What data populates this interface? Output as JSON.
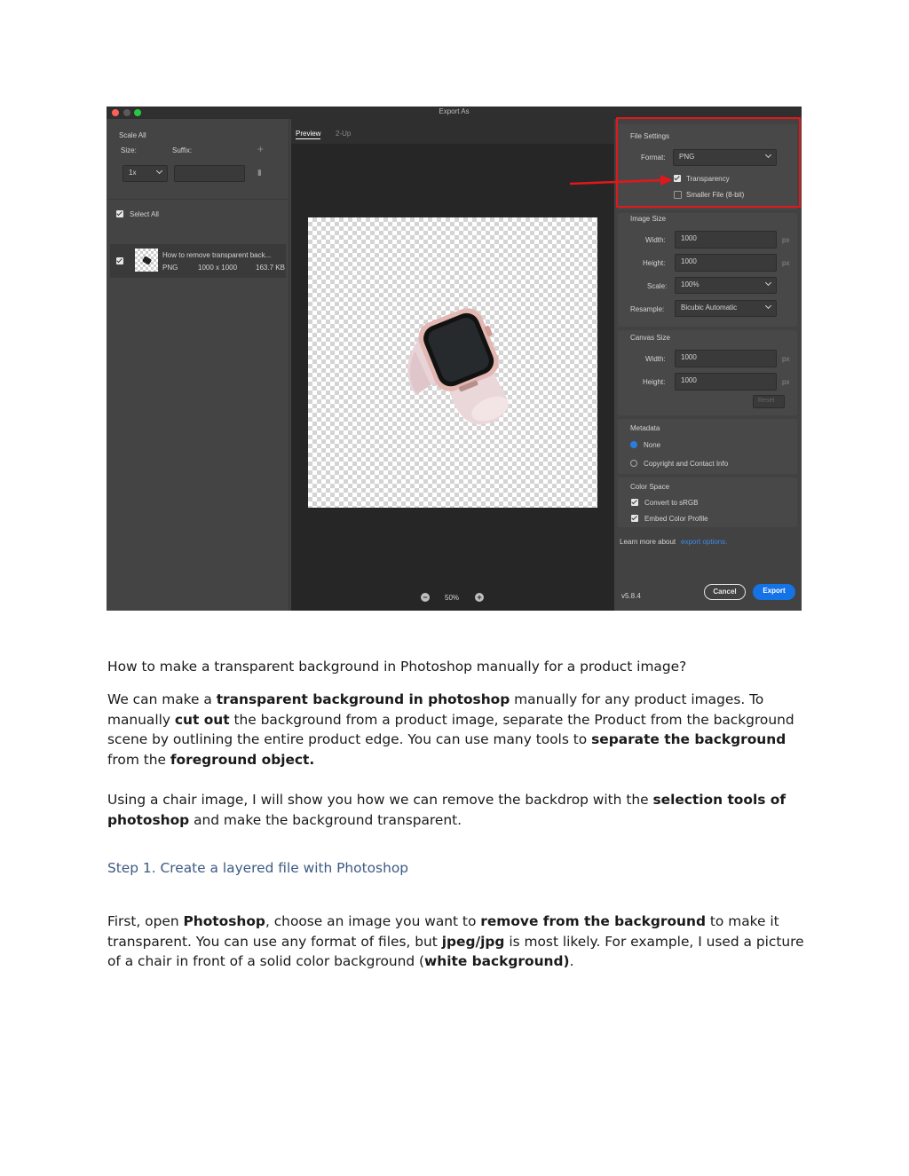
{
  "dialog": {
    "window_title": "Export As",
    "left": {
      "scale_all": "Scale All",
      "size_label": "Size:",
      "suffix_label": "Suffix:",
      "size_value": "1x",
      "select_all": "Select All",
      "file_name": "How to remove transparent back...",
      "file_format": "PNG",
      "file_dims": "1000 x 1000",
      "file_size": "163.7 KB"
    },
    "tabs": [
      "Preview",
      "2-Up"
    ],
    "zoom": "50%",
    "file_settings": {
      "heading": "File Settings",
      "format_label": "Format:",
      "format_value": "PNG",
      "transparency": "Transparency",
      "smaller_file": "Smaller File (8-bit)"
    },
    "image_size": {
      "heading": "Image Size",
      "width_label": "Width:",
      "width_value": "1000",
      "height_label": "Height:",
      "height_value": "1000",
      "scale_label": "Scale:",
      "scale_value": "100%",
      "resample_label": "Resample:",
      "resample_value": "Bicubic Automatic",
      "unit": "px"
    },
    "canvas_size": {
      "heading": "Canvas Size",
      "width_label": "Width:",
      "width_value": "1000",
      "height_label": "Height:",
      "height_value": "1000",
      "unit": "px",
      "reset": "Reset"
    },
    "metadata": {
      "heading": "Metadata",
      "none": "None",
      "copyright": "Copyright and Contact Info"
    },
    "color_space": {
      "heading": "Color Space",
      "convert": "Convert to sRGB",
      "embed": "Embed Color Profile"
    },
    "learn_more": "Learn more about",
    "export_options": "export options.",
    "version": "v5.8.4",
    "cancel": "Cancel",
    "export": "Export",
    "colors": {
      "highlight": "#e0181b",
      "accent": "#1473e6"
    }
  },
  "article": {
    "heading": "How to make a transparent background in Photoshop manually for a product image?",
    "p1": {
      "t1": "We can make a ",
      "b1": "transparent background in photoshop",
      "t2": " manually for any product images. To manually ",
      "b2": "cut out",
      "t3": " the background from a product image, separate the Product from the background scene by outlining the entire product edge. You can use many tools to ",
      "b3": "separate the background",
      "t4": " from the ",
      "b4": "foreground object."
    },
    "p2": {
      "t1": "Using a chair image, I will show you how we can remove the backdrop with the ",
      "b1": "selection tools of photoshop",
      "t2": " and make the background transparent."
    },
    "step1": "Step 1. Create a layered file with Photoshop",
    "p3": {
      "t1": "First, open ",
      "b1": "Photoshop",
      "t2": ", choose an image you want to ",
      "b2": "remove from the background",
      "t3": " to make it transparent. You can use any format of files, but ",
      "b3": "jpeg/jpg",
      "t4": " is most likely. For example, I used a picture of a chair in front of a solid color background (",
      "b4": "white background)",
      "t5": "."
    },
    "step_color": "#3c5a83"
  }
}
